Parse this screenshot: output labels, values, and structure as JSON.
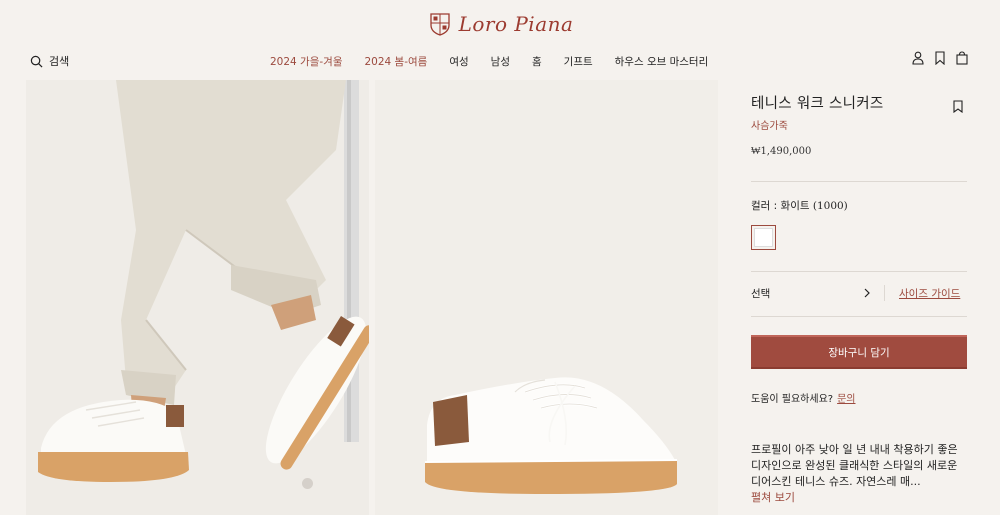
{
  "brand": {
    "name": "Loro Piana",
    "color": "#9c3b30"
  },
  "header": {
    "search_label": "검색",
    "nav": [
      {
        "label": "2024 가을-겨울",
        "accent": true
      },
      {
        "label": "2024 봄-여름",
        "accent": true
      },
      {
        "label": "여성",
        "accent": false
      },
      {
        "label": "남성",
        "accent": false
      },
      {
        "label": "홈",
        "accent": false
      },
      {
        "label": "기프트",
        "accent": false
      },
      {
        "label": "하우스 오브 마스터리",
        "accent": false
      }
    ],
    "icons": [
      "account-icon",
      "wishlist-icon",
      "bag-icon"
    ]
  },
  "gallery": {
    "images": [
      "model-wearing-sneakers",
      "sneaker-side-view"
    ],
    "pager_dots": 1
  },
  "product": {
    "title": "테니스 워크 스니커즈",
    "material": "사슴가죽",
    "price": "₩1,490,000",
    "color_prefix": "컬러 : 화이트 ",
    "color_code": "(1000)",
    "swatch_color": "#ffffff",
    "size_select_label": "선택",
    "size_guide_label": "사이즈 가이드",
    "add_to_cart_label": "장바구니 담기",
    "accent_color": "#a04b3f",
    "help_text": "도움이 필요하세요?",
    "help_link": "문의",
    "description": "프로필이 아주 낮아 일 년 내내 착용하기 좋은 디자인으로 완성된 클래식한 스타일의 새로운 디어스킨 테니스 슈즈. 자연스레 매...",
    "read_more": "펼쳐 보기"
  }
}
